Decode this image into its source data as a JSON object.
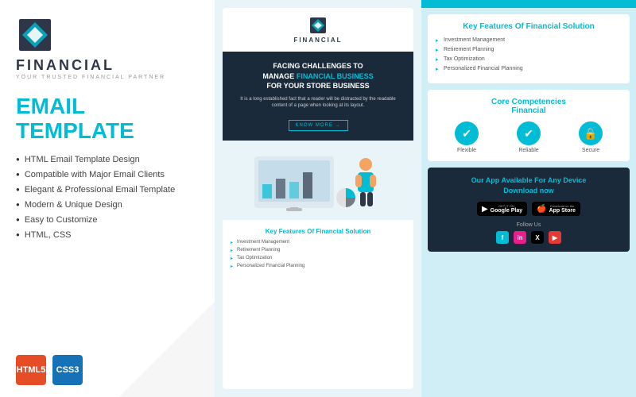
{
  "left": {
    "logo_text": "FINANCIAL",
    "logo_sub": "YOUR TRUSTED FINANCIAL PARTNER",
    "title": "EMAIL TEMPLATE",
    "features": [
      "HTML Email Template Design",
      "Compatible with Major Email Clients",
      "Elegant & Professional Email Template",
      "Modern & Unique Design",
      "Easy to Customize",
      "HTML, CSS"
    ],
    "badge_html": "HTML5",
    "badge_css": "CSS3"
  },
  "center": {
    "logo_text": "FINANCIAL",
    "hero_line1": "FACING CHALLENGES TO",
    "hero_line2": "MANAGE",
    "hero_highlight": "FINANCIAL BUSINESS",
    "hero_line3": "FOR YOUR",
    "hero_bold": "STORE BUSINESS",
    "hero_body": "It is a long established fact that a reader will be distracted by the readable content of a page when looking at its layout.",
    "btn_label": "KNOW MORE →",
    "features_title": "Key Features Of",
    "features_highlight": "Financial Solution",
    "features": [
      "Investment Management",
      "Retirement Planning",
      "Tax Optimization",
      "Personalized Financial Planning"
    ]
  },
  "right": {
    "key_features_title": "Key Features Of",
    "key_features_highlight": "Financial Solution",
    "key_features": [
      "Investment Management",
      "Retirement Planning",
      "Tax Optimization",
      "Personalized Financial Planning"
    ],
    "competencies_title": "Core Competencies",
    "competencies_highlight": "Financial",
    "competencies": [
      {
        "icon": "✔",
        "label": "Flexible"
      },
      {
        "icon": "✔",
        "label": "Reliable"
      },
      {
        "icon": "🔒",
        "label": "Secure"
      }
    ],
    "app_title": "Our App Available For Any Device",
    "app_subtitle": "Download now",
    "google_play_small": "GET IT ON",
    "google_play_big": "Google Play",
    "app_store_small": "Download on the",
    "app_store_big": "App Store",
    "follow_label": "Follow Us",
    "social": [
      "f",
      "in",
      "X",
      "▶"
    ]
  }
}
